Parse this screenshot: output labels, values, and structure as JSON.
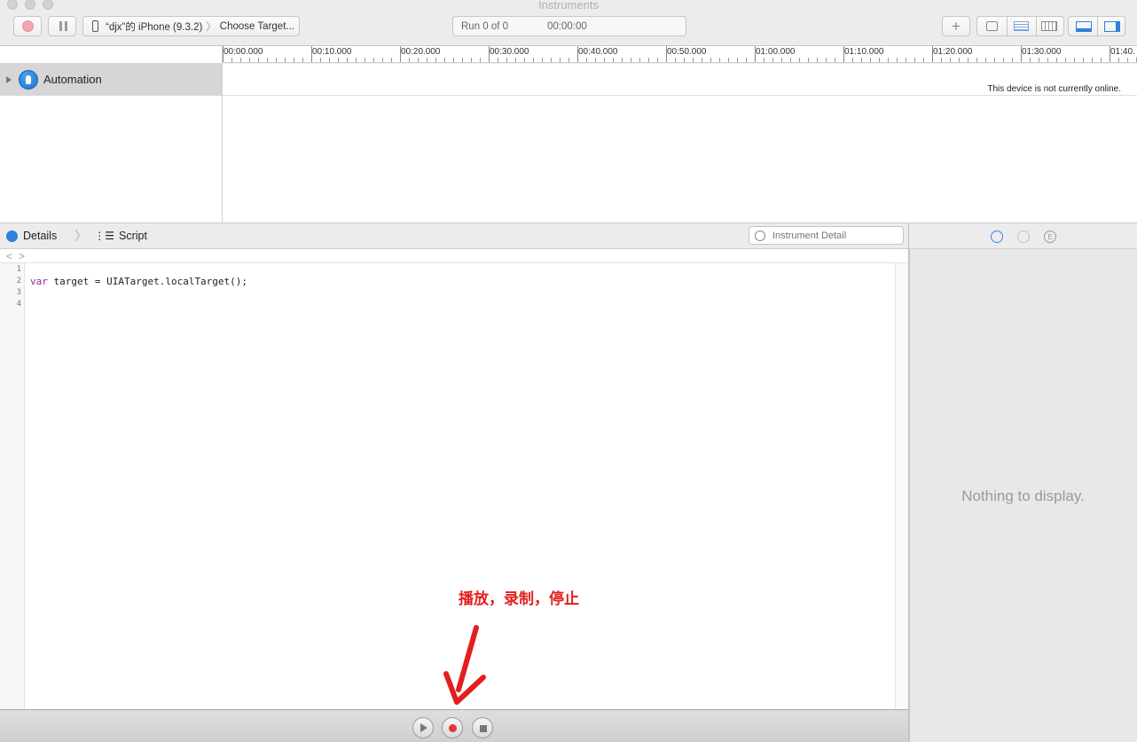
{
  "window": {
    "title": "Instruments"
  },
  "toolbar": {
    "device_label": "“djx”的 iPhone (9.3.2)",
    "target_label": "Choose Target...",
    "run_label": "Run 0 of 0",
    "run_time": "00:00:00",
    "add_symbol": "+"
  },
  "timeline": {
    "ticks": [
      "00:00.000",
      "00:10.000",
      "00:20.000",
      "00:30.000",
      "00:40.000",
      "00:50.000",
      "01:00.000",
      "01:10.000",
      "01:20.000",
      "01:30.000",
      "01:40."
    ],
    "offline_message": "This device is not currently online."
  },
  "instruments": [
    {
      "name": "Automation",
      "icon": "automation-icon"
    }
  ],
  "detail": {
    "crumb_details": "Details",
    "crumb_script": "Script",
    "search_placeholder": "Instrument Detail"
  },
  "editor": {
    "line_numbers": [
      "1",
      "2",
      "3",
      "4"
    ],
    "code": {
      "keyword": "var",
      "rest": " target = UIATarget.localTarget();"
    }
  },
  "annotation": {
    "text": "播放，录制，停止",
    "color": "#e41e1e"
  },
  "inspector": {
    "empty_text": "Nothing to display."
  },
  "colors": {
    "accent": "#2e80d8",
    "record": "#e5373d"
  }
}
